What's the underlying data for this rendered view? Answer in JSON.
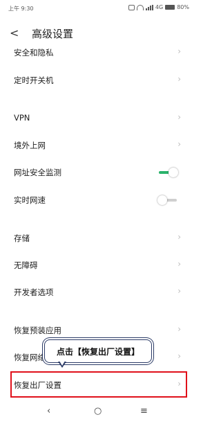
{
  "status": {
    "time": "上午 9:30",
    "network": "4G",
    "battery": "80%"
  },
  "header": {
    "title": "高级设置",
    "back_icon": "chevron-left-icon"
  },
  "rows": [
    {
      "label": "安全和隐私",
      "kind": "chevron"
    },
    {
      "label": "定时开关机",
      "kind": "chevron"
    },
    {
      "label": "VPN",
      "kind": "chevron"
    },
    {
      "label": "境外上网",
      "kind": "chevron"
    },
    {
      "label": "网址安全监测",
      "kind": "toggle",
      "on": true
    },
    {
      "label": "实时网速",
      "kind": "toggle",
      "on": false
    },
    {
      "label": "存储",
      "kind": "chevron"
    },
    {
      "label": "无障碍",
      "kind": "chevron"
    },
    {
      "label": "开发者选项",
      "kind": "chevron"
    },
    {
      "label": "恢复预装应用",
      "kind": "chevron"
    },
    {
      "label": "恢复网络设置",
      "kind": "chevron"
    },
    {
      "label": "恢复出厂设置",
      "kind": "chevron"
    }
  ],
  "callout": {
    "text": "点击【恢复出厂设置】"
  },
  "colors": {
    "toggle_on": "#2bb36b",
    "highlight_border": "#e0101a",
    "callout_border": "#2a3a66"
  },
  "navbar": {
    "back_icon": "nav-back-icon",
    "home_icon": "nav-home-icon",
    "menu_icon": "nav-menu-icon"
  }
}
